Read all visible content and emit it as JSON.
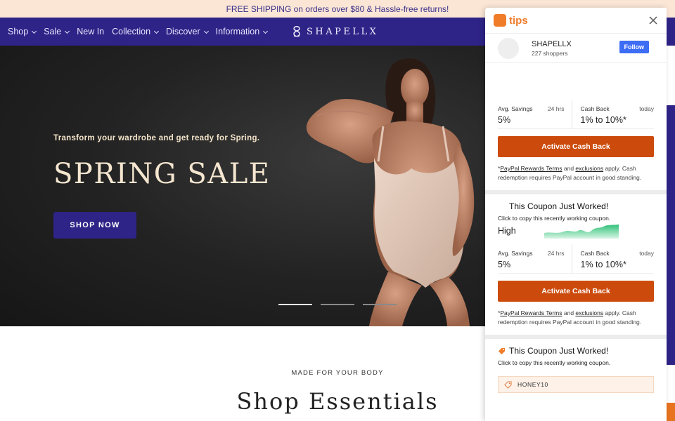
{
  "announcement": "FREE SHIPPING on orders over $80 & Hassle-free returns!",
  "nav": {
    "items": [
      {
        "label": "Shop",
        "dropdown": true
      },
      {
        "label": "Sale",
        "dropdown": true
      },
      {
        "label": "New In",
        "dropdown": false
      },
      {
        "label": "Collection",
        "dropdown": true
      },
      {
        "label": "Discover",
        "dropdown": true
      },
      {
        "label": "Information",
        "dropdown": true
      }
    ],
    "logo": "SHAPELLX"
  },
  "hero": {
    "subtitle": "Transform your wardrobe and get ready for Spring.",
    "title": "SPRING SALE",
    "button": "SHOP NOW",
    "slides": 3,
    "active_slide": 1
  },
  "essentials": {
    "eyebrow": "MADE FOR YOUR BODY",
    "title": "Shop Essentials"
  },
  "panel": {
    "brand": "tips",
    "store": {
      "name": "SHAPELLX",
      "shoppers": "227 shoppers",
      "follow": "Follow"
    },
    "block1": {
      "avg_label": "Avg. Savings",
      "avg_time": "24 hrs",
      "avg_value": "5%",
      "cb_label": "Cash Back",
      "cb_time": "today",
      "cb_value": "1% to 10%*",
      "cta": "Activate Cash Back"
    },
    "terms": {
      "prefix": "*",
      "link1": "PayPal Rewards Terms",
      "and": " and ",
      "link2": "exclusions",
      "rest": " apply. Cash redemption requires PayPal account in good standing."
    },
    "coupon1": {
      "title": "This Coupon Just Worked!",
      "subtitle": "Click to copy this recently working coupon.",
      "level": "High"
    },
    "block2": {
      "avg_label": "Avg. Savings",
      "avg_time": "24 hrs",
      "avg_value": "5%",
      "cb_label": "Cash Back",
      "cb_time": "today",
      "cb_value": "1% to 10%*",
      "cta": "Activate Cash Back"
    },
    "coupon2": {
      "title": "This Coupon Just Worked!",
      "subtitle": "Click to copy this recently working coupon.",
      "code": "HONEY10"
    }
  },
  "colors": {
    "accent": "#2e2386",
    "orange": "#cc4b0c",
    "tips": "#f07c2a",
    "follow": "#3d6cf5"
  }
}
